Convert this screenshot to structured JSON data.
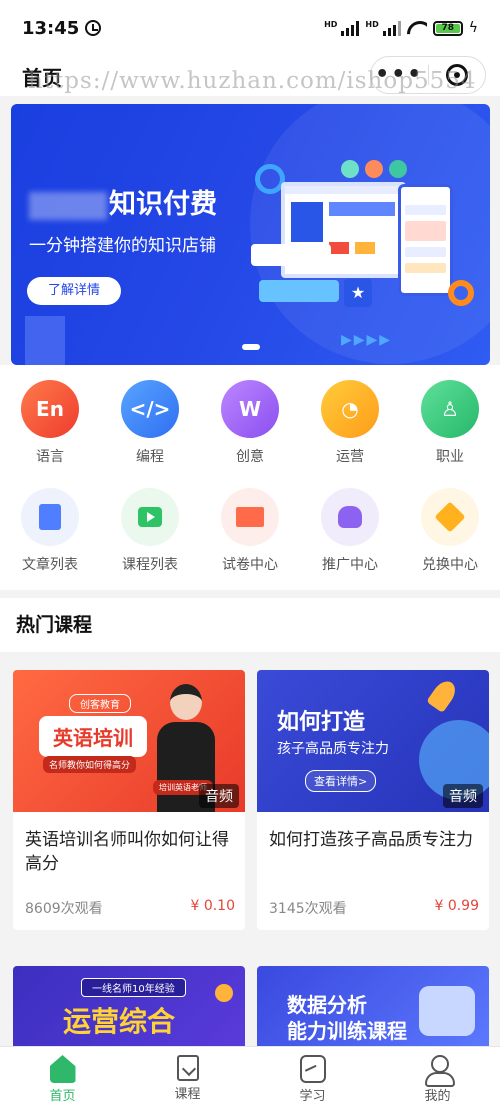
{
  "status": {
    "time": "13:45",
    "signal_label_1": "HD",
    "signal_label_2": "HD",
    "battery": "78"
  },
  "header": {
    "title": "首页",
    "watermark": "https://www.huzhan.com/ishop5554"
  },
  "banner": {
    "title_suffix": "知识付费",
    "subtitle": "一分钟搭建你的知识店铺",
    "button": "了解详情"
  },
  "categories": [
    {
      "label": "语言",
      "icon": "en-icon",
      "glyph": "En"
    },
    {
      "label": "编程",
      "icon": "code-icon",
      "glyph": "</>"
    },
    {
      "label": "创意",
      "icon": "bulb-icon",
      "glyph": "W"
    },
    {
      "label": "运营",
      "icon": "chart-icon",
      "glyph": "◔"
    },
    {
      "label": "职业",
      "icon": "person-icon",
      "glyph": "♙"
    }
  ],
  "shortcuts": [
    {
      "label": "文章列表",
      "icon": "article-icon"
    },
    {
      "label": "课程列表",
      "icon": "video-icon"
    },
    {
      "label": "试卷中心",
      "icon": "book-icon"
    },
    {
      "label": "推广中心",
      "icon": "money-bag-icon"
    },
    {
      "label": "兑换中心",
      "icon": "diamond-icon"
    }
  ],
  "hot": {
    "title": "热门课程",
    "courses": [
      {
        "name": "英语培训名师叫你如何让得高分",
        "views": "8609次观看",
        "price": "¥ 0.10",
        "tag": "音频",
        "thumb_small": "创客教育",
        "thumb_big": "英语培训",
        "thumb_sub": "名师教你如何得高分",
        "thumb_badge": "培训英语老师"
      },
      {
        "name": "如何打造孩子高品质专注力",
        "views": "3145次观看",
        "price": "¥ 0.99",
        "tag": "音频",
        "thumb_big": "如何打造",
        "thumb_sub": "孩子高品质专注力",
        "thumb_btn": "查看详情>"
      },
      {
        "thumb_label": "一线名师10年经验",
        "thumb_big": "运营综合"
      },
      {
        "thumb_big": "数据分析\n能力训练课程"
      }
    ]
  },
  "tabbar": [
    {
      "label": "首页",
      "active": true
    },
    {
      "label": "课程",
      "active": false
    },
    {
      "label": "学习",
      "active": false
    },
    {
      "label": "我的",
      "active": false
    }
  ]
}
